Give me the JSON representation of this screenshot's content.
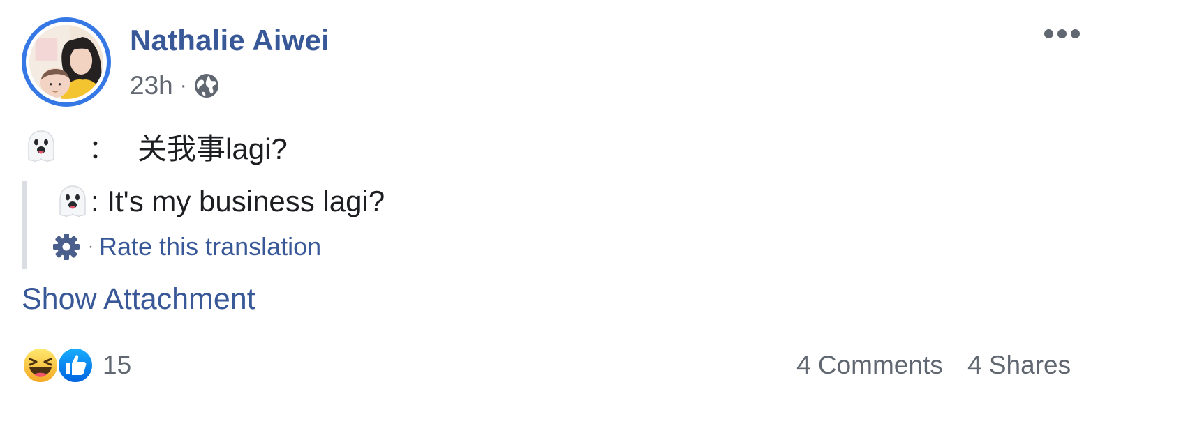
{
  "post": {
    "author_name": "Nathalie Aiwei",
    "timestamp": "23h",
    "meta_separator": "·",
    "privacy_icon": "globe-icon",
    "more_icon": "more-horizontal-icon",
    "avatar_icon": "profile-photo-avatar"
  },
  "content": {
    "emoji": "ghost-emoji",
    "original_colon": "：",
    "original_text": "关我事lagi?",
    "translation": {
      "text": ": It's my business lagi?",
      "separator": "·",
      "settings_icon": "gear-icon",
      "rate_link": "Rate this translation"
    },
    "show_attachment": "Show Attachment"
  },
  "footer": {
    "reaction_icons": [
      "haha-emoji",
      "like-emoji"
    ],
    "reaction_count": "15",
    "comments": "4 Comments",
    "shares": "4 Shares"
  },
  "colors": {
    "link": "#385898",
    "secondary_text": "#606770",
    "avatar_ring": "#3578e5",
    "quote_border": "#dadde1",
    "like_blue": "#1877f2",
    "haha_yellow": "#f7b928"
  }
}
